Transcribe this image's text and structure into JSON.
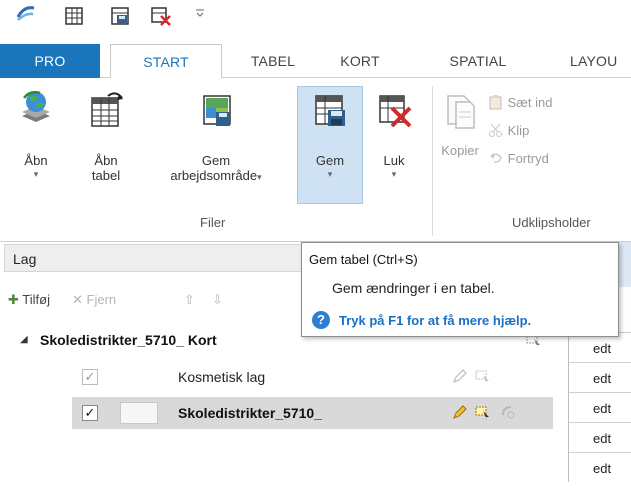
{
  "quick_access": {
    "caret": "₹"
  },
  "tabs": {
    "pro": "PRO",
    "start": "START",
    "tabel": "TABEL",
    "kort": "KORT",
    "spatial": "SPATIAL",
    "layout": "LAYOU"
  },
  "ribbon": {
    "filer": {
      "label": "Filer",
      "aabn": "Åbn",
      "aabn_tabel_line1": "Åbn",
      "aabn_tabel_line2": "tabel",
      "gem_arbejdsomraade_line1": "Gem",
      "gem_arbejdsomraade_line2": "arbejdsområde",
      "gem": "Gem",
      "luk": "Luk"
    },
    "udklipsholder": {
      "label": "Udklipsholder",
      "kopier": "Kopier",
      "saet_ind": "Sæt ind",
      "klip": "Klip",
      "fortryd": "Fortryd"
    }
  },
  "panel": {
    "title": "Lag",
    "toolbar": {
      "tilfoej": "Tilføj",
      "fjern": "Fjern"
    },
    "tree": {
      "root": "Skoledistrikter_5710_ Kort",
      "layers": [
        {
          "name": "Kosmetisk lag",
          "checked": true
        },
        {
          "name": "Skoledistrikter_5710_",
          "checked": true
        }
      ]
    }
  },
  "table_fragment": {
    "cells": [
      "edt",
      "edt",
      "edt",
      "edt",
      "edt"
    ]
  },
  "tooltip": {
    "title": "Gem tabel  (Ctrl+S)",
    "description": "Gem ændringer i en tabel.",
    "help": "Tryk på F1 for at få mere hjælp."
  },
  "colors": {
    "accent": "#1a75bb",
    "pro_tab_bg": "#1a75bb",
    "gem_highlight": "#cfe2f3",
    "help_link": "#1a6fc6"
  }
}
